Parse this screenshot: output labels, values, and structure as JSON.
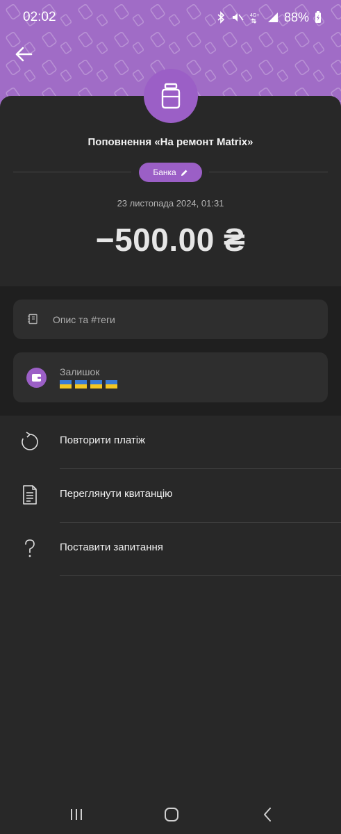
{
  "status_bar": {
    "time": "02:02",
    "battery": "88%",
    "network": "4G+"
  },
  "header": {
    "background_color": "#a06cc6",
    "back_icon": "arrow-left-icon"
  },
  "transaction": {
    "icon": "jar-icon",
    "title": "Поповнення «На ремонт Matrix»",
    "category_label": "Банка",
    "category_icon": "pencil-icon",
    "date": "23 листопада 2024, 01:31",
    "amount": "−500.00 ₴"
  },
  "description_card": {
    "icon": "notebook-icon",
    "placeholder": "Опис та #теги"
  },
  "balance_card": {
    "icon": "wallet-icon",
    "label": "Залишок",
    "value_flags": 4
  },
  "actions": [
    {
      "icon": "repeat-icon",
      "label": "Повторити платіж"
    },
    {
      "icon": "receipt-icon",
      "label": "Переглянути квитанцію"
    },
    {
      "icon": "question-icon",
      "label": "Поставити запитання"
    }
  ],
  "colors": {
    "accent": "#9b5fc6",
    "background": "#282828",
    "card": "#2e2e2e"
  }
}
